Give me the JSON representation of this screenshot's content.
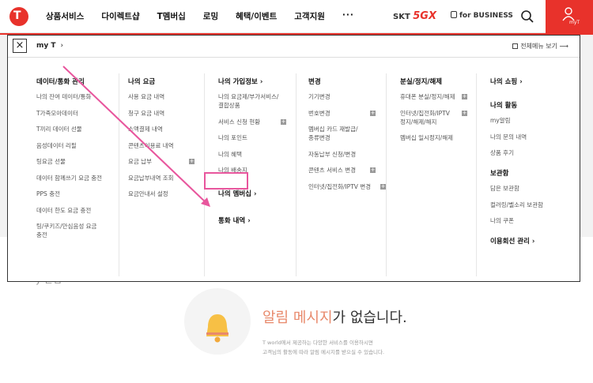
{
  "brand": {
    "logo_letter": "T",
    "accent": "#e8322b"
  },
  "gnb": [
    "상품서비스",
    "다이렉트샵",
    "T멤버십",
    "로밍",
    "혜택/이벤트",
    "고객지원"
  ],
  "gnb_more": "···",
  "skt_label": "SKT",
  "skt_5g": "5GX",
  "biz_label": "for BUSINESS",
  "myt_label": "myT",
  "panel": {
    "close": "×",
    "title": "my T",
    "title_chevron": "›",
    "full_menu": "전체메뉴 보기 ⟶"
  },
  "columns": [
    {
      "title": "데이터/통화 관리",
      "items": [
        "나의 잔여 데이터/통화",
        "T가족모아데이터",
        "T끼리 데이터 선물",
        "음성데이터 리필",
        "팅요금 선물",
        "데이터 함께쓰기 요금 충전",
        "PPS 충전",
        "데이터 한도 요금 충전",
        "팅/쿠키즈/안심음성 요금",
        "충전"
      ]
    },
    {
      "title": "나의 요금",
      "items": [
        "사용 요금 내역",
        "청구 요금 내역",
        "소액결제 내역",
        "콘텐츠이용료 내역",
        "요금 납부",
        "요금납부내역 조회",
        "요금안내서 설정"
      ]
    },
    {
      "title": "나의 가입정보 ›",
      "items": [
        "나의 요금제/부가서비스/",
        "결합상품",
        "서비스 신청 현황",
        "나의 포인트",
        "나의 혜택",
        "나의 배송지"
      ],
      "sec2_title": "나의 멤버십 ›",
      "sec3_title": "통화 내역 ›"
    },
    {
      "title": "변경",
      "items": [
        "기기변경",
        "번호변경",
        "멤버십 카드 재발급/",
        "종류변경",
        "자동납부 신청/변경",
        "콘텐츠 서비스 변경",
        "인터넷/집전화/IPTV 변경"
      ]
    },
    {
      "title": "분실/정지/해제",
      "items": [
        "휴대폰 분실/정지/해제",
        "인터넷/집전화/IPTV",
        "정지/해제/해지",
        "멤버십 일시정지/해제"
      ]
    },
    {
      "title": "나의 쇼핑 ›",
      "sec2_title": "나의 활동",
      "sec2_items": [
        "my알림",
        "나의 문의 내역",
        "상품 후기"
      ],
      "sec3_title": "보관함",
      "sec3_items": [
        "담은 보관함",
        "컬러링/벨소리 보관함",
        "나의 쿠폰"
      ],
      "sec4_title": "이용회선 관리 ›"
    }
  ],
  "plus_sign": "+",
  "background": {
    "partial": "y 알림",
    "empty_highlight": "알림 메시지",
    "empty_rest": "가 없습니다.",
    "sub_line1": "T world에서 제공하는 다양한 서비스를 이용하시면",
    "sub_line2": "고객님의 활동에 따라 알림 메시지를 받으실 수 있습니다."
  },
  "highlight_color": "#e8569d"
}
